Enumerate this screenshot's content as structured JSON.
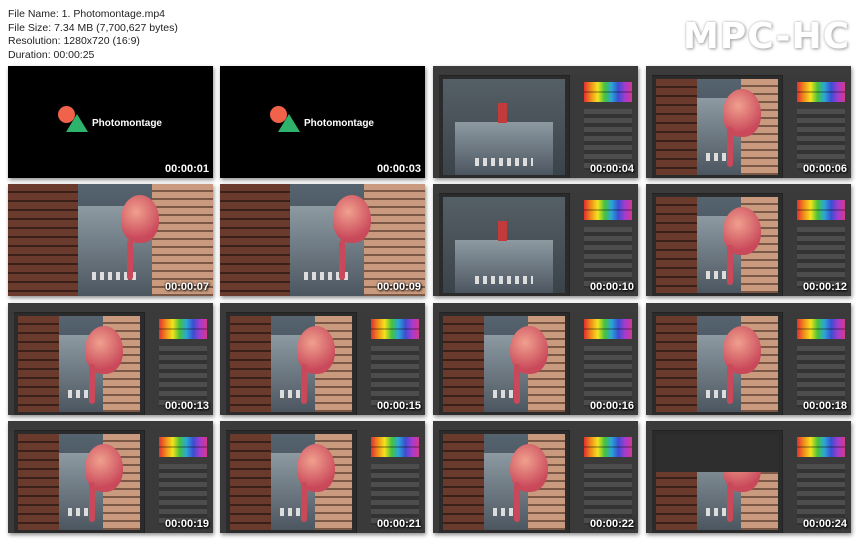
{
  "file_info": {
    "name": "File Name: 1. Photomontage.mp4",
    "size": "File Size: 7.34 MB (7,700,627 bytes)",
    "resolution": "Resolution: 1280x720 (16:9)",
    "duration": "Duration: 00:00:25"
  },
  "logo": "MPC-HC",
  "title_text": "Photomontage",
  "thumbnails": [
    {
      "time": "00:00:01",
      "kind": "title"
    },
    {
      "time": "00:00:03",
      "kind": "title"
    },
    {
      "time": "00:00:04",
      "kind": "ps-street"
    },
    {
      "time": "00:00:06",
      "kind": "ps-city"
    },
    {
      "time": "00:00:07",
      "kind": "city"
    },
    {
      "time": "00:00:09",
      "kind": "city"
    },
    {
      "time": "00:00:10",
      "kind": "ps-street"
    },
    {
      "time": "00:00:12",
      "kind": "ps-city"
    },
    {
      "time": "00:00:13",
      "kind": "ps-city"
    },
    {
      "time": "00:00:15",
      "kind": "ps-city"
    },
    {
      "time": "00:00:16",
      "kind": "ps-city"
    },
    {
      "time": "00:00:18",
      "kind": "ps-city"
    },
    {
      "time": "00:00:19",
      "kind": "ps-city"
    },
    {
      "time": "00:00:21",
      "kind": "ps-city"
    },
    {
      "time": "00:00:22",
      "kind": "ps-city"
    },
    {
      "time": "00:00:24",
      "kind": "ps-crop"
    }
  ],
  "colors": {
    "background": "#ffffff",
    "ps_dark": "#2b2b2b",
    "flamingo": "#c9485a",
    "title_circle": "#f0624a",
    "title_triangle": "#2db36b"
  }
}
